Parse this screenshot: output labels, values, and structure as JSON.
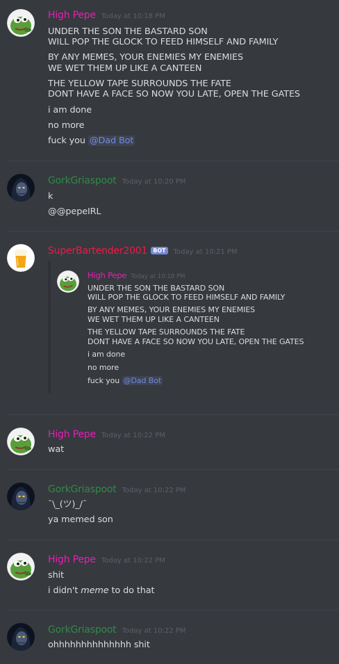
{
  "colors": {
    "background": "#36393e",
    "high_pepe": "#e91eb5",
    "gork": "#2f8a4a",
    "bartender": "#ec1a4a",
    "mention": "#7289da",
    "timestamp": "#5d6066"
  },
  "messages": [
    {
      "username": "High Pepe",
      "timestamp": "Today at 10:18 PM",
      "avatar_icon": "pepe-frog-icon",
      "lines": [
        "UNDER THE SON THE BASTARD SON",
        "WILL POP THE GLOCK TO FEED HIMSELF AND FAMILY",
        "BY ANY MEMES, YOUR ENEMIES MY ENEMIES",
        "WE WET THEM UP LIKE A CANTEEN",
        "THE YELLOW TAPE SURROUNDS THE FATE",
        "DONT HAVE A FACE SO NOW YOU LATE, OPEN THE GATES",
        "i am done",
        "no more",
        "fuck you "
      ],
      "mention": "@Dad Bot"
    },
    {
      "username": "GorkGriaspoot",
      "timestamp": "Today at 10:20 PM",
      "avatar_icon": "hooded-figure-icon",
      "lines": [
        "k",
        "@@pepeIRL"
      ]
    },
    {
      "username": "SuperBartender2001",
      "bot_tag": "BOT",
      "timestamp": "Today at 10:21 PM",
      "avatar_icon": "beer-glass-icon",
      "embed": {
        "username": "High Pepe",
        "timestamp": "Today at 10:18 PM",
        "lines": [
          "UNDER THE SON THE BASTARD SON",
          "WILL POP THE GLOCK TO FEED HIMSELF AND FAMILY",
          "BY ANY MEMES, YOUR ENEMIES MY ENEMIES",
          "WE WET THEM UP LIKE A CANTEEN",
          "THE YELLOW TAPE SURROUNDS THE FATE",
          "DONT HAVE A FACE SO NOW YOU LATE, OPEN THE GATES",
          "i am done",
          "no more",
          "fuck you "
        ],
        "mention": "@Dad Bot"
      }
    },
    {
      "username": "High Pepe",
      "timestamp": "Today at 10:22 PM",
      "avatar_icon": "pepe-frog-icon",
      "lines": [
        "wat"
      ]
    },
    {
      "username": "GorkGriaspoot",
      "timestamp": "Today at 10:22 PM",
      "avatar_icon": "hooded-figure-icon",
      "lines": [
        "¯\\_(ツ)_/¯",
        "ya memed son"
      ]
    },
    {
      "username": "High Pepe",
      "timestamp": "Today at 10:22 PM",
      "avatar_icon": "pepe-frog-icon",
      "lines": [
        "shit"
      ],
      "italic_line": {
        "before": "i didn't ",
        "italic": "meme",
        "after": " to do that"
      }
    },
    {
      "username": "GorkGriaspoot",
      "timestamp": "Today at 10:22 PM",
      "avatar_icon": "hooded-figure-icon",
      "lines": [
        "ohhhhhhhhhhhhhh shit"
      ]
    }
  ]
}
